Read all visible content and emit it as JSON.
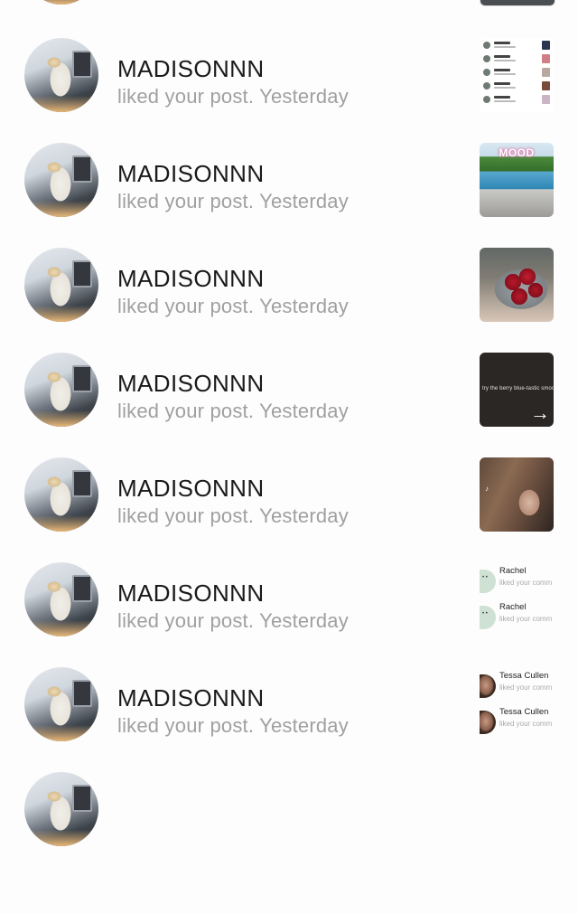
{
  "notifications": [
    {
      "username": "MADISONNN",
      "action": "liked your post.",
      "time": "Yesterday",
      "thumbnail": "notification-list-screenshot"
    },
    {
      "username": "MADISONNN",
      "action": "liked your post.",
      "time": "Yesterday",
      "thumbnail": "pool-photo"
    },
    {
      "username": "MADISONNN",
      "action": "liked your post.",
      "time": "Yesterday",
      "thumbnail": "strawberries-photo"
    },
    {
      "username": "MADISONNN",
      "action": "liked your post.",
      "time": "Yesterday",
      "thumbnail": "video-caption"
    },
    {
      "username": "MADISONNN",
      "action": "liked your post.",
      "time": "Yesterday",
      "thumbnail": "video-selfie"
    },
    {
      "username": "MADISONNN",
      "action": "liked your post.",
      "time": "Yesterday",
      "thumbnail": "notification-preview-rachel"
    },
    {
      "username": "MADISONNN",
      "action": "liked your post.",
      "time": "Yesterday",
      "thumbnail": "notification-preview-tessa"
    }
  ],
  "thumb_texts": {
    "pool_overlay": "MOOD",
    "video_caption": "try the berry blue-tastic smoothie",
    "arrow": "→"
  },
  "mini_previews": {
    "rachel": [
      {
        "name": "Rachel",
        "sub": "liked your comm"
      },
      {
        "name": "Rachel",
        "sub": "liked your comm"
      }
    ],
    "tessa": [
      {
        "name": "Tessa Cullen",
        "sub": "liked your comm"
      },
      {
        "name": "Tessa Cullen",
        "sub": "liked your comm"
      }
    ]
  }
}
